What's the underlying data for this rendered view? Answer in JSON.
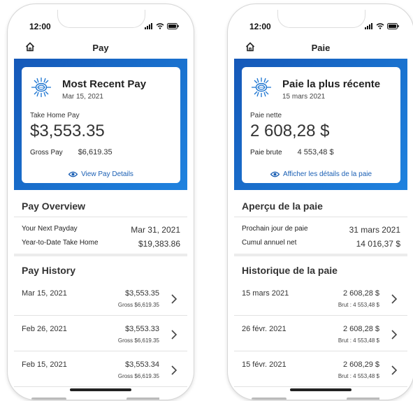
{
  "phones": [
    {
      "status_time": "12:00",
      "header_title": "Pay",
      "card_title": "Most Recent Pay",
      "card_date": "Mar 15, 2021",
      "take_home_label": "Take Home Pay",
      "take_home_amount": "$3,553.35",
      "gross_label": "Gross Pay",
      "gross_amount": "$6,619.35",
      "details_link": "View Pay Details",
      "overview_title": "Pay Overview",
      "next_payday_label": "Your Next Payday",
      "next_payday_value": "Mar 31, 2021",
      "ytd_label": "Year-to-Date Take Home",
      "ytd_value": "$19,383.86",
      "history_title": "Pay History",
      "history": [
        {
          "date": "Mar 15, 2021",
          "amount": "$3,553.35",
          "gross": "Gross $6,619.35"
        },
        {
          "date": "Feb 26, 2021",
          "amount": "$3,553.33",
          "gross": "Gross $6,619.35"
        },
        {
          "date": "Feb 15, 2021",
          "amount": "$3,553.34",
          "gross": "Gross $6,619.35"
        }
      ]
    },
    {
      "status_time": "12:00",
      "header_title": "Paie",
      "card_title": "Paie la plus récente",
      "card_date": "15 mars 2021",
      "take_home_label": "Paie nette",
      "take_home_amount": "2 608,28 $",
      "gross_label": "Paie brute",
      "gross_amount": "4 553,48 $",
      "details_link": "Afficher les détails de la paie",
      "overview_title": "Aperçu de la paie",
      "next_payday_label": "Prochain jour de paie",
      "next_payday_value": "31 mars 2021",
      "ytd_label": "Cumul annuel net",
      "ytd_value": "14 016,37 $",
      "history_title": "Historique de la paie",
      "history": [
        {
          "date": "15 mars 2021",
          "amount": "2 608,28 $",
          "gross": "Brut : 4 553,48 $"
        },
        {
          "date": "26 févr. 2021",
          "amount": "2 608,28 $",
          "gross": "Brut : 4 553,48 $"
        },
        {
          "date": "15 févr. 2021",
          "amount": "2 608,29 $",
          "gross": "Brut : 4 553,48 $"
        }
      ]
    }
  ],
  "colors": {
    "brand_blue": "#1a73d0",
    "link_blue": "#1a5fb4"
  },
  "icons": [
    "home-icon",
    "sun-logo-icon",
    "eye-icon",
    "chevron-right-icon",
    "signal-icon",
    "wifi-icon",
    "battery-icon"
  ]
}
